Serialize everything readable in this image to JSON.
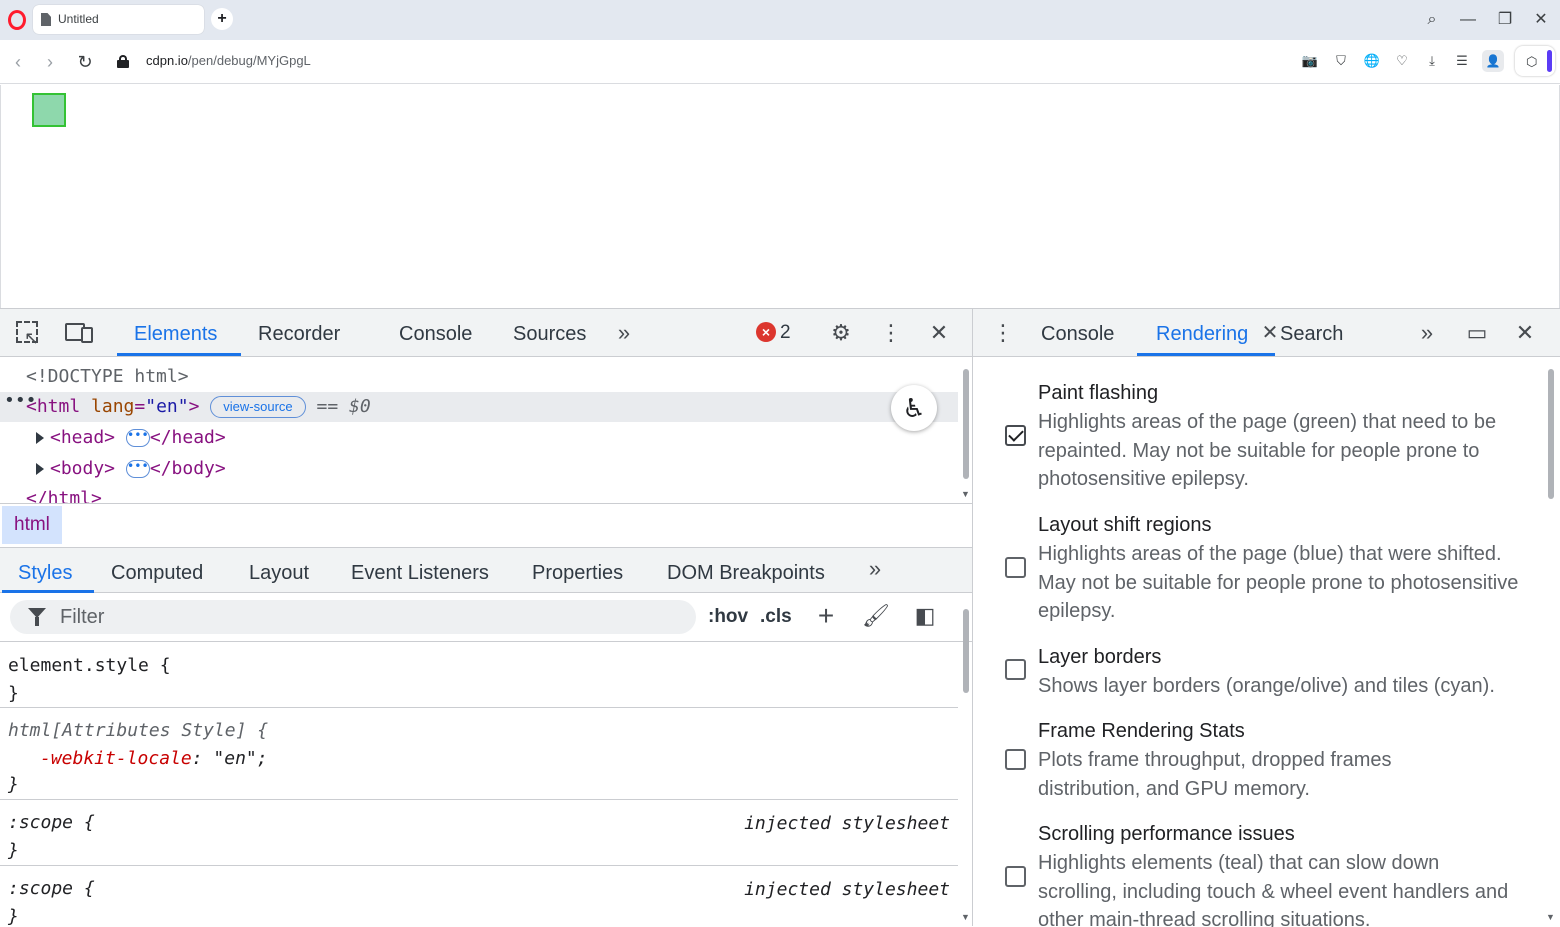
{
  "browser": {
    "tab_title": "Untitled",
    "new_tab_symbol": "+",
    "url_host": "cdpn.io",
    "url_path": "/pen/debug/MYjGpgL"
  },
  "devtools": {
    "tabs": [
      "Elements",
      "Recorder",
      "Console",
      "Sources"
    ],
    "active_tab": "Elements",
    "error_count": "2",
    "tree": {
      "doctype": "<!DOCTYPE html>",
      "html_open": "<html",
      "html_attr_name": "lang",
      "html_attr_val": "\"en\"",
      "html_close_bracket": ">",
      "view_source": "view-source",
      "eq_sel": "== $0",
      "head_open": "<head>",
      "head_close": "</head>",
      "body_open": "<body>",
      "body_close": "</body>",
      "html_end": "</html>"
    },
    "breadcrumb": "html",
    "sub_tabs": [
      "Styles",
      "Computed",
      "Layout",
      "Event Listeners",
      "Properties",
      "DOM Breakpoints"
    ],
    "active_sub_tab": "Styles",
    "filter_placeholder": "Filter",
    "hov_label": ":hov",
    "cls_label": ".cls",
    "rules": [
      {
        "selector": "element.style {",
        "close": "}"
      },
      {
        "selector": "html[Attributes Style] {",
        "prop": "-webkit-locale",
        "value": "\"en\";",
        "close": "}"
      },
      {
        "selector": ":scope {",
        "origin": "injected stylesheet",
        "close": "}"
      },
      {
        "selector": ":scope {",
        "origin": "injected stylesheet",
        "close": "}"
      }
    ]
  },
  "drawer": {
    "tabs": [
      "Console",
      "Rendering",
      "Search"
    ],
    "active_tab": "Rendering",
    "options": [
      {
        "title": "Paint flashing",
        "desc": "Highlights areas of the page (green) that need to be repainted. May not be suitable for people prone to photosensitive epilepsy.",
        "checked": true
      },
      {
        "title": "Layout shift regions",
        "desc": "Highlights areas of the page (blue) that were shifted. May not be suitable for people prone to photosensitive epilepsy.",
        "checked": false
      },
      {
        "title": "Layer borders",
        "desc": "Shows layer borders (orange/olive) and tiles (cyan).",
        "checked": false
      },
      {
        "title": "Frame Rendering Stats",
        "desc": "Plots frame throughput, dropped frames distribution, and GPU memory.",
        "checked": false
      },
      {
        "title": "Scrolling performance issues",
        "desc": "Highlights elements (teal) that can slow down scrolling, including touch & wheel event handlers and other main-thread scrolling situations.",
        "checked": false
      }
    ]
  },
  "colors": {
    "accent": "#1a73e8",
    "paint_flash_fill": "#8ed8ac",
    "paint_flash_border": "#34c234",
    "error": "#dc362e",
    "opera_red": "#ff1b2d"
  }
}
